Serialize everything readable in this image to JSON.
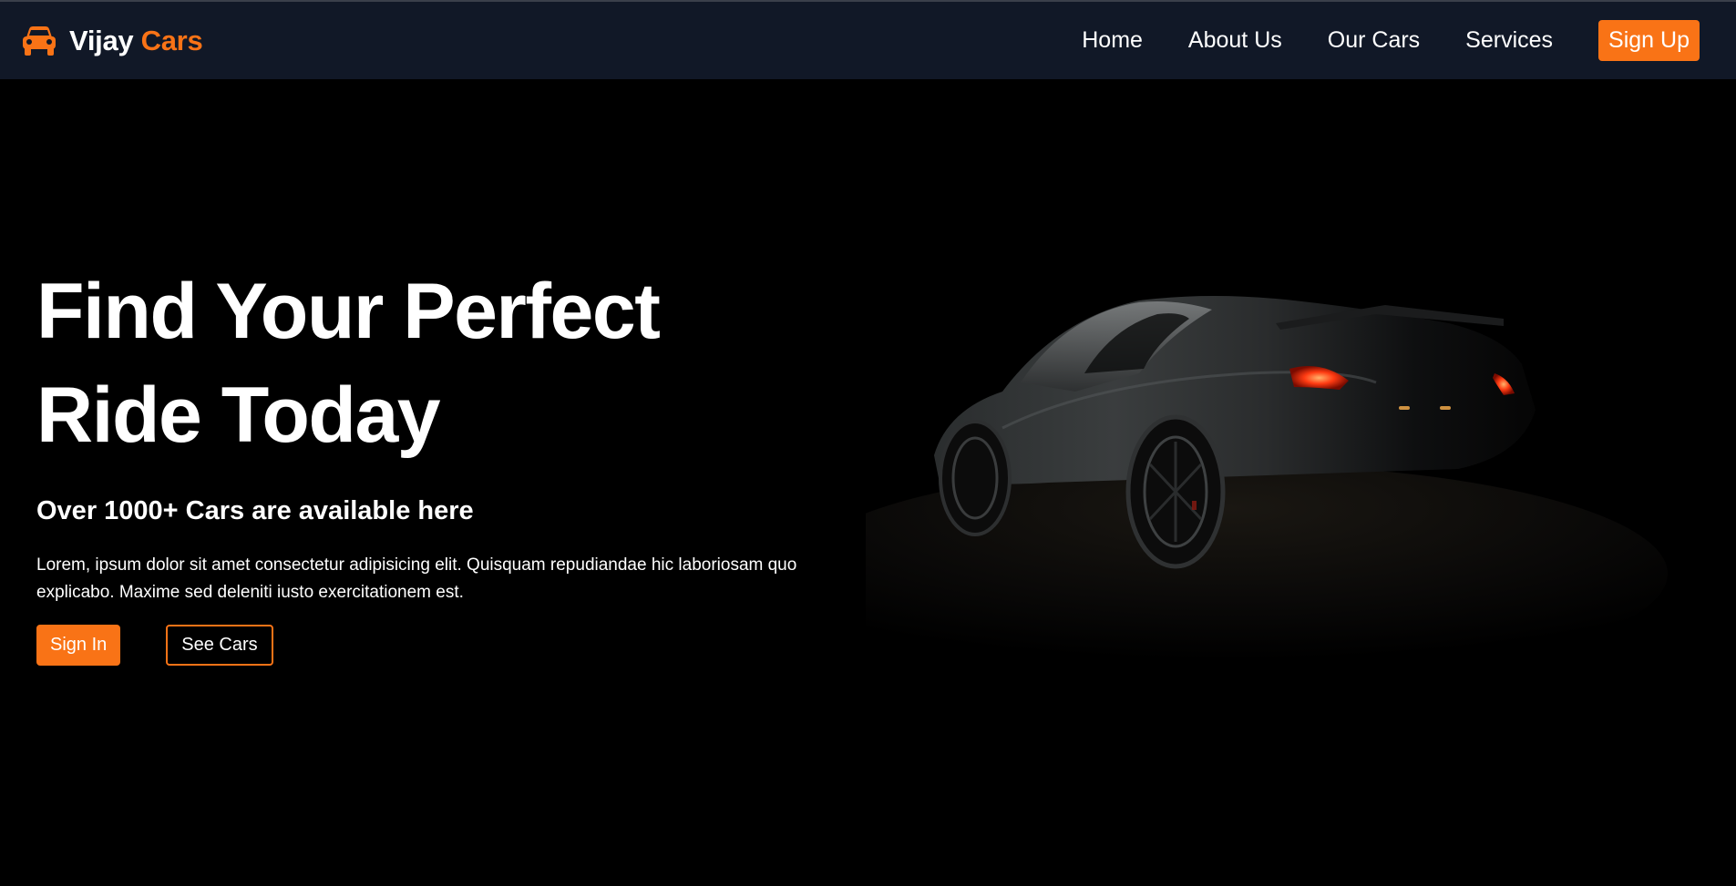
{
  "brand": {
    "icon": "car-icon",
    "name_main": "Vijay",
    "name_accent": "Cars",
    "accent_color": "#f97316"
  },
  "nav": {
    "links": [
      "Home",
      "About Us",
      "Our Cars",
      "Services"
    ],
    "cta": "Sign Up"
  },
  "hero": {
    "title_line1": "Find Your Perfect",
    "title_line2": "Ride Today",
    "subtitle": "Over 1000+ Cars are available here",
    "description": "Lorem, ipsum dolor sit amet consectetur adipisicing elit. Quisquam repudiandae hic laboriosam quo explicabo. Maxime sed deleniti iusto exercitationem est.",
    "primary_button": "Sign In",
    "secondary_button": "See Cars",
    "image": "dark-sports-car-photo"
  },
  "colors": {
    "navbar_bg": "#111827",
    "page_bg": "#000000",
    "accent": "#f97316"
  }
}
